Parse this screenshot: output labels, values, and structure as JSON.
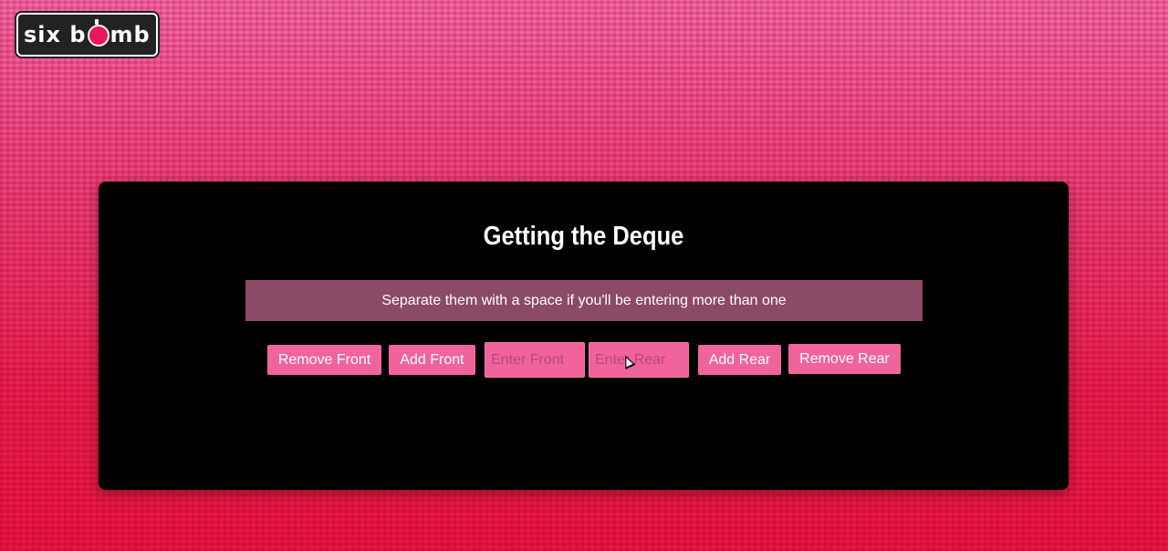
{
  "logo": {
    "text_left": "six b",
    "text_right": "mb"
  },
  "panel": {
    "title": "Getting the Deque",
    "hint": "Separate them with a space if you'll be entering more than one",
    "buttons": {
      "remove_front": "Remove Front",
      "add_front": "Add Front",
      "add_rear": "Add Rear",
      "remove_rear": "Remove Rear"
    },
    "inputs": {
      "front_placeholder": "Enter Front",
      "rear_placeholder": "Enter Rear"
    }
  },
  "colors": {
    "background": "#f0275e",
    "panel": "#000000",
    "hint_bar": "#8b4a66",
    "button": "#f0649b"
  }
}
